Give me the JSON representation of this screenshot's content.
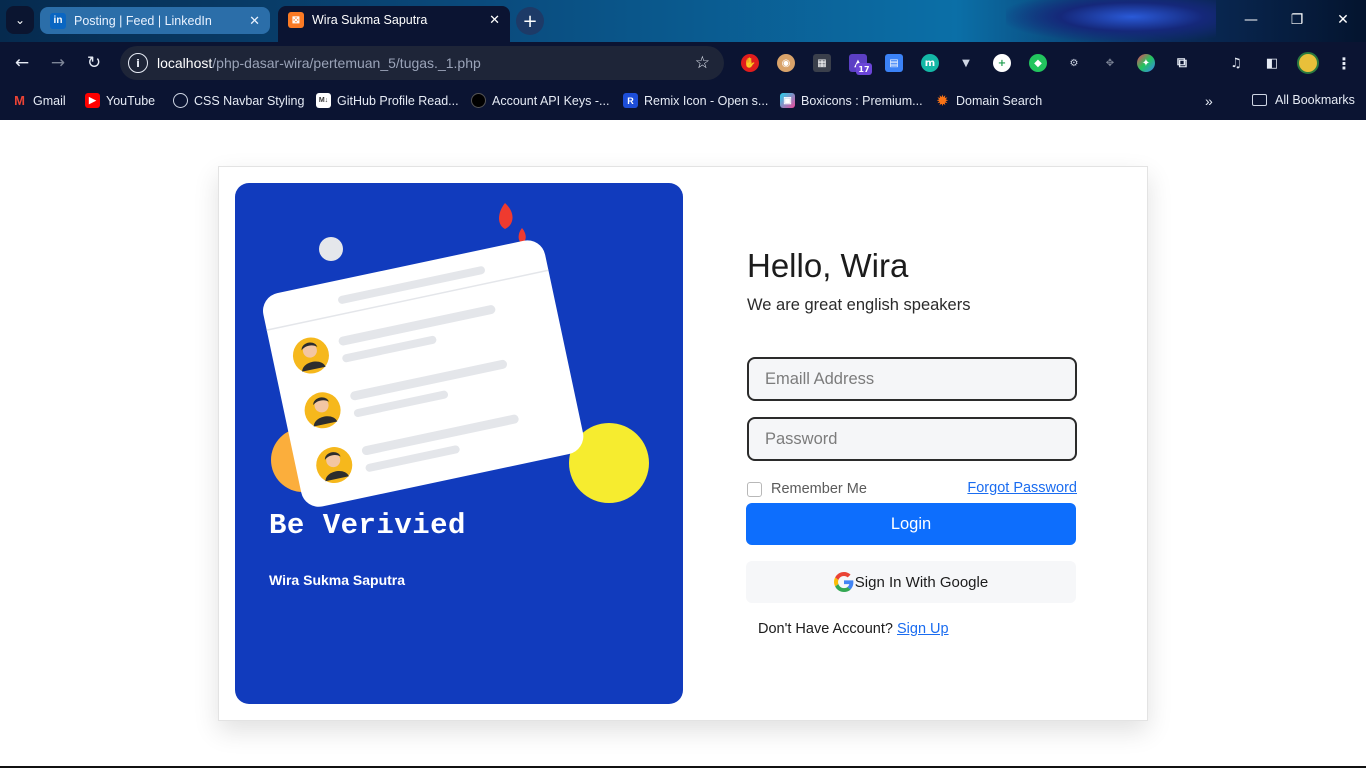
{
  "browser": {
    "tabs": [
      {
        "title": "Posting | Feed | LinkedIn",
        "favicon": "linkedin-icon",
        "active": false
      },
      {
        "title": "Wira Sukma Saputra",
        "favicon": "xampp-icon",
        "active": true
      }
    ],
    "url_host": "localhost",
    "url_path": "/php-dasar-wira/pertemuan_5/tugas._1.php",
    "bookmarks": [
      {
        "label": "Gmail",
        "icon": "gmail-icon"
      },
      {
        "label": "YouTube",
        "icon": "youtube-icon"
      },
      {
        "label": "CSS Navbar Styling",
        "icon": "chatgpt-icon"
      },
      {
        "label": "GitHub Profile Read...",
        "icon": "markdown-icon"
      },
      {
        "label": "Account API Keys -...",
        "icon": "openai-icon"
      },
      {
        "label": "Remix Icon - Open s...",
        "icon": "remix-icon"
      },
      {
        "label": "Boxicons : Premium...",
        "icon": "boxicons-icon"
      },
      {
        "label": "Domain Search",
        "icon": "domain-icon"
      }
    ],
    "all_bookmarks": "All Bookmarks",
    "extension_badge": "17"
  },
  "left_panel": {
    "headline": "Be Verivied",
    "author": "Wira Sukma Saputra",
    "bg_color": "#113bbd"
  },
  "login": {
    "greeting": "Hello, Wira",
    "subtitle": "We are great english speakers",
    "email_placeholder": "Emaill Address",
    "password_placeholder": "Password",
    "remember_label": "Remember Me",
    "forgot_label": "Forgot Password",
    "login_label": "Login",
    "google_label": "Sign In With Google",
    "no_account_text": "Don't Have Account?",
    "signup_label": "Sign Up",
    "accent_color": "#0d6efd"
  }
}
